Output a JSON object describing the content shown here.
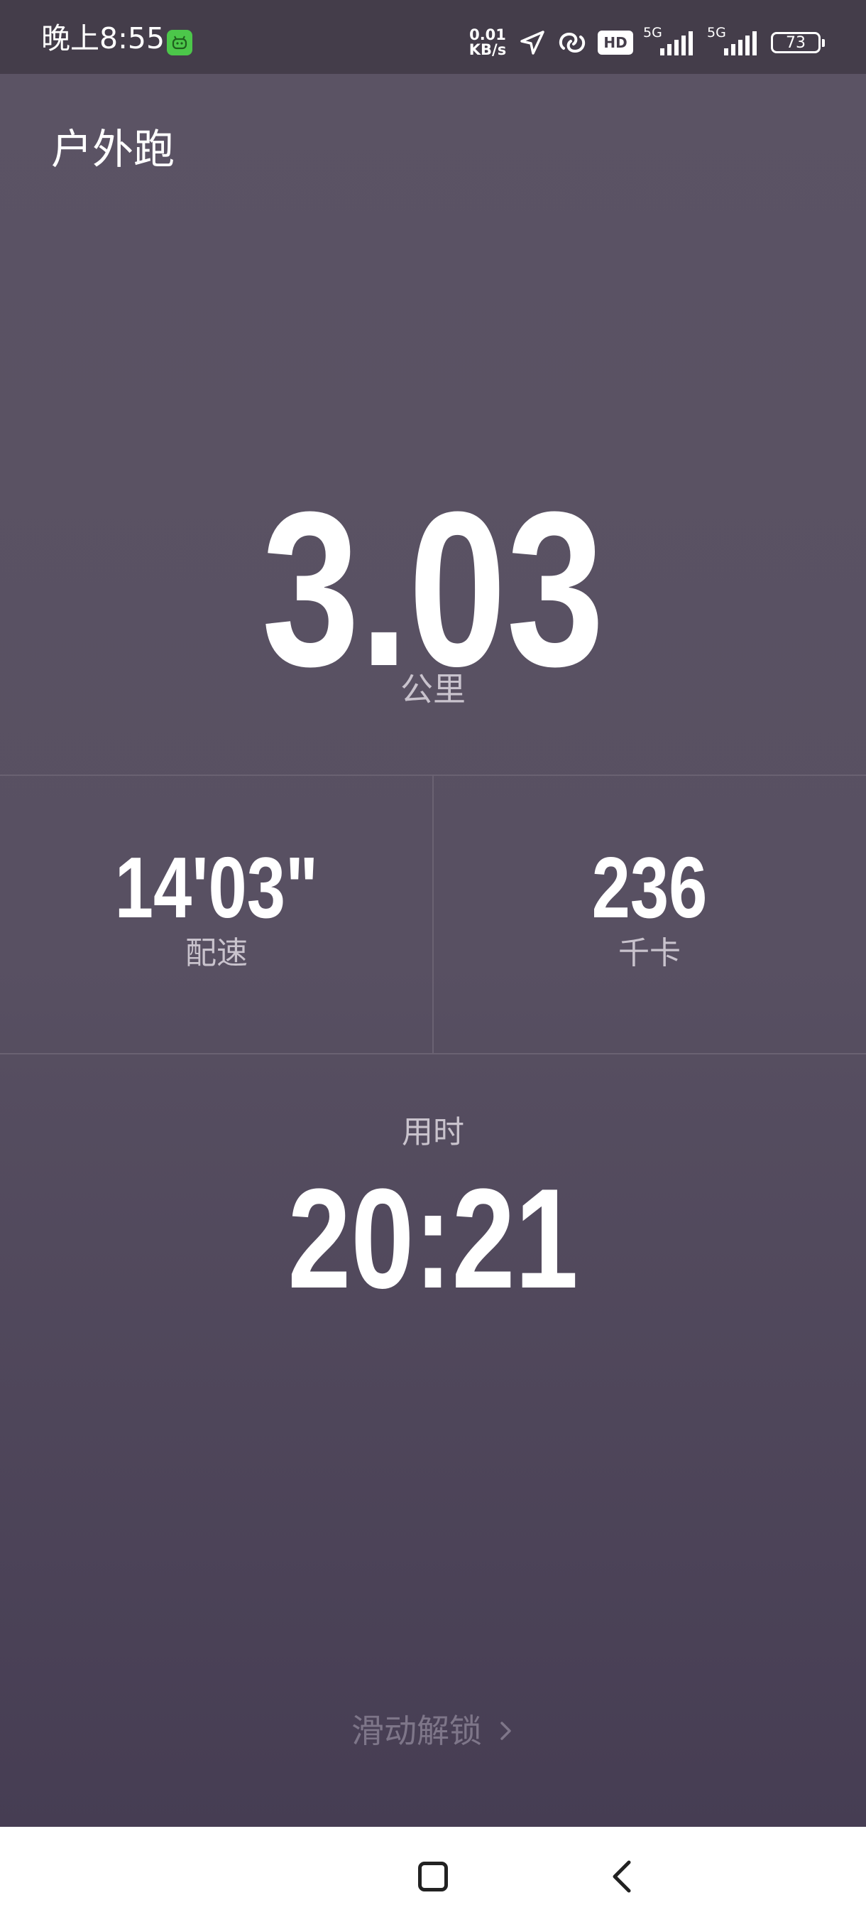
{
  "status_bar": {
    "time": "晚上8:55",
    "net_speed_value": "0.01",
    "net_speed_unit": "KB/s",
    "hd_label": "HD",
    "signal1_label": "5G",
    "signal2_label": "5G",
    "battery_level": "73",
    "app_icon": "android-robot-icon"
  },
  "header": {
    "title": "户外跑"
  },
  "distance": {
    "value": "3.03",
    "unit": "公里"
  },
  "pace": {
    "value": "14'03\"",
    "label": "配速"
  },
  "calories": {
    "value": "236",
    "label": "千卡"
  },
  "duration": {
    "label": "用时",
    "value": "20:21"
  },
  "unlock": {
    "label": "滑动解锁"
  },
  "nav_bar": {
    "home_icon": "square-home-icon",
    "back_icon": "chevron-left-back-icon"
  },
  "colors": {
    "status_bg": "#443d4a",
    "page_bg_top": "#5b5364",
    "page_bg_bottom": "#463d53",
    "secondary_text": "#c9c3cd",
    "unlock_text": "#7e7689",
    "app_icon": "#4cc74a"
  }
}
